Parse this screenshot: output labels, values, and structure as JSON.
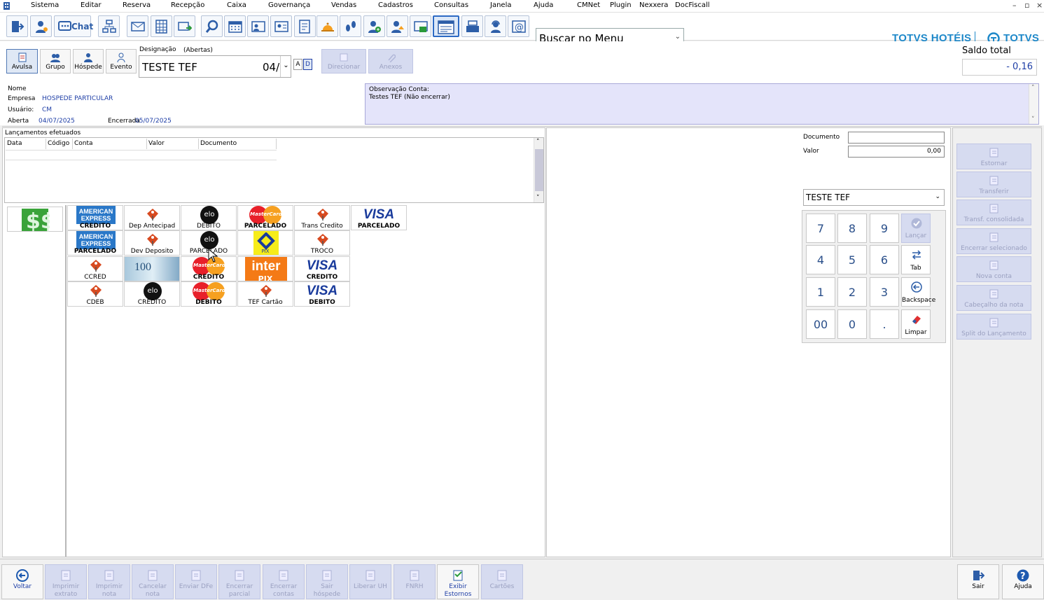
{
  "menu": {
    "items": [
      "Sistema",
      "Editar",
      "Reserva",
      "Recepção",
      "Caixa",
      "Governança",
      "Vendas",
      "Cadastros",
      "Consultas",
      "Janela",
      "Ajuda",
      "CMNet",
      "Plugin",
      "Nexxera",
      "DocFiscall"
    ],
    "window_controls": [
      "–",
      "▫",
      "×"
    ]
  },
  "toolbar": {
    "chat_label": "Chat",
    "search_value": "Buscar no Menu",
    "brand_hotels": "TOTVS HOTÉIS",
    "brand_totvs": "TOTVS"
  },
  "account": {
    "type_buttons": [
      "Avulsa",
      "Grupo",
      "Hóspede",
      "Evento"
    ],
    "designacao_label": "Designação",
    "designacao_status": "(Abertas)",
    "designacao_value": "TESTE TEF",
    "designacao_number": "04/",
    "btn_a": "A",
    "btn_d": "D",
    "direcionar": "Direcionar",
    "anexos": "Anexos",
    "saldo_label": "Saldo total",
    "saldo_value": "- 0,16"
  },
  "info": {
    "nome_label": "Nome",
    "empresa_label": "Empresa",
    "empresa_value": "HOSPEDE PARTICULAR",
    "usuario_label": "Usuário:",
    "usuario_value": "CM",
    "aberta_label": "Aberta",
    "aberta_value": "04/07/2025",
    "encerrada_label": "Encerrada",
    "encerrada_value": "05/07/2025",
    "obs_label": "Observação Conta:",
    "obs_value": "Testes TEF (Não encerrar)"
  },
  "lancamentos": {
    "title": "Lançamentos efetuados",
    "columns": [
      "Data",
      "Código",
      "Conta",
      "Valor",
      "Documento"
    ]
  },
  "payments": [
    {
      "logo": "amex",
      "label": "CREDITO"
    },
    {
      "logo": "tag",
      "label": "Dep Antecipad"
    },
    {
      "logo": "elo",
      "label": "DEBITO"
    },
    {
      "logo": "mastercard",
      "label": "PARCELADO"
    },
    {
      "logo": "tag",
      "label": "Trans Credito"
    },
    {
      "logo": "visa",
      "label": "PARCELADO"
    },
    {
      "logo": "amex",
      "label": "PARCELADO"
    },
    {
      "logo": "tag",
      "label": "Dev Deposito"
    },
    {
      "logo": "elo",
      "label": "PARCELADO"
    },
    {
      "logo": "pix",
      "label": "PIX"
    },
    {
      "logo": "tag",
      "label": "TROCO"
    },
    {
      "logo": "tag",
      "label": "CCRED"
    },
    {
      "logo": "cash",
      "label": "100"
    },
    {
      "logo": "mastercard",
      "label": "CREDITO"
    },
    {
      "logo": "inter",
      "label": "PIX"
    },
    {
      "logo": "visa",
      "label": "CREDITO"
    },
    {
      "logo": "tag",
      "label": "CDEB"
    },
    {
      "logo": "elo",
      "label": "CREDITO"
    },
    {
      "logo": "mastercard",
      "label": "DEBITO"
    },
    {
      "logo": "tag",
      "label": "TEF Cartão"
    },
    {
      "logo": "visa",
      "label": "DEBITO"
    }
  ],
  "brand_text": {
    "amex_line1": "AMERICAN",
    "amex_line2": "EXPRESS",
    "visa": "VISA",
    "elo": "elo",
    "mastercard": "MasterCard",
    "inter": "inter",
    "pix": "PIX",
    "cash": "100"
  },
  "entry": {
    "documento_label": "Documento",
    "documento_value": "",
    "valor_label": "Valor",
    "valor_value": "0,00",
    "account_select": "TESTE TEF"
  },
  "keypad": {
    "rows": [
      [
        "7",
        "8",
        "9"
      ],
      [
        "4",
        "5",
        "6"
      ],
      [
        "1",
        "2",
        "3"
      ],
      [
        "00",
        "0",
        "."
      ]
    ],
    "actions": [
      "Lançar",
      "Tab",
      "Backspace",
      "Limpar"
    ]
  },
  "side_actions": [
    "Estornar",
    "Transferir",
    "Transf. consolidada",
    "Encerrar selecionado",
    "Nova conta",
    "Cabeçalho da nota",
    "Split do Lançamento"
  ],
  "bottom_actions": [
    {
      "label": "Voltar",
      "enabled": true
    },
    {
      "label": "Imprimir extrato",
      "enabled": false
    },
    {
      "label": "Imprimir nota",
      "enabled": false
    },
    {
      "label": "Cancelar nota",
      "enabled": false
    },
    {
      "label": "Enviar DFe",
      "enabled": false
    },
    {
      "label": "Encerrar parcial",
      "enabled": false
    },
    {
      "label": "Encerrar contas",
      "enabled": false
    },
    {
      "label": "Sair hóspede",
      "enabled": false
    },
    {
      "label": "Liberar UH",
      "enabled": false
    },
    {
      "label": "FNRH",
      "enabled": false
    },
    {
      "label": "Exibir Estornos",
      "enabled": true
    },
    {
      "label": "Cartões",
      "enabled": false
    }
  ],
  "bottom_right": [
    "Sair",
    "Ajuda"
  ],
  "colors": {
    "accent": "#1e3ea6",
    "disabled_bg": "#d6dbf0",
    "obs_bg": "#e4e4fa",
    "brand": "#1e88c9"
  }
}
